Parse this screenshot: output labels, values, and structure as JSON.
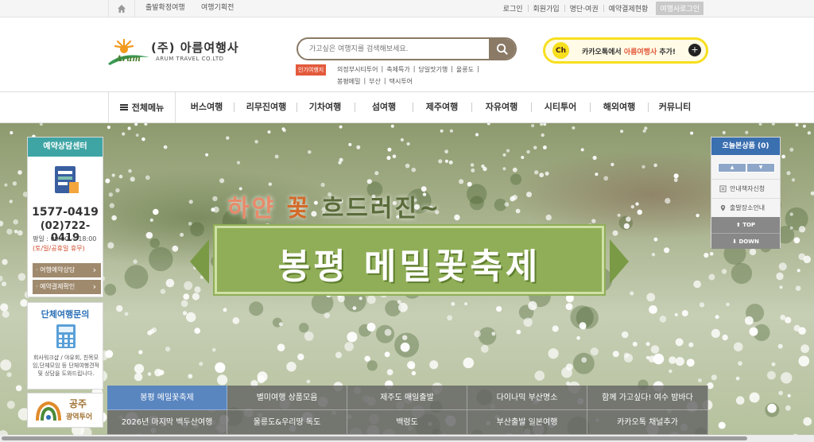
{
  "topbar": {
    "links": [
      "출발확정여행",
      "여행기획전"
    ],
    "util": [
      "로그인",
      "회원가입",
      "명단·여권",
      "예약결제현황"
    ],
    "agent_login": "여행사로그인"
  },
  "logo": {
    "arum": "Arum",
    "main": "(주) 아름여행사",
    "sub": "ARUM TRAVEL CO.LTD"
  },
  "search": {
    "placeholder": "가고싶은 여행지를 검색해보세요."
  },
  "popular": {
    "label": "인기여행지",
    "row1": [
      "의정부시티투어",
      "|",
      "축제특가",
      "|",
      "당일맛기행",
      "|",
      "울릉도",
      "|"
    ],
    "row2": [
      "봉평메밀",
      "|",
      "부산",
      "|",
      "택시투어"
    ]
  },
  "kakao": {
    "ch": "Ch",
    "text_pre": "카카오톡에서 ",
    "text_em": "아름여행사",
    "text_post": " 추가!",
    "plus": "+"
  },
  "nav": {
    "all": "전체메뉴",
    "items": [
      "버스여행",
      "리무진여행",
      "기차여행",
      "섬여행",
      "제주여행",
      "자유여행",
      "시티투어",
      "해외여행",
      "커뮤니티"
    ]
  },
  "hero": {
    "sub_a": "하얀 ",
    "sub_b": "꽃",
    "sub_c": " 흐드러진~",
    "title": "봉평 메밀꽃축제",
    "colors": {
      "sub": "#e88a6a",
      "sub_accent": "#d46a2a",
      "sub_dark": "#5a6b3a",
      "banner": "#8fae57"
    }
  },
  "left": {
    "head": "예약상담센터",
    "tel1": "1577-0419",
    "tel2": "(02)722-0419",
    "hours": "평일 : 09:00 ~ 18:00",
    "off": "(토/일/공휴일 휴무)",
    "btn1": "· 여행예약상담",
    "btn2": "· 예약결제확인",
    "group_title": "단체여행문의",
    "group_desc": "회사워크샵 / 야유회, 친목모임,단체모임 등 단체여행견적 및 상담을 도와드립니다.",
    "gongju1": "공주",
    "gongju2": "광역투어"
  },
  "right": {
    "head": "오늘본상품 (0)",
    "up": "▲",
    "down": "▼",
    "link1": "안내책자신청",
    "link2": "출발장소안내",
    "top": "⬆ TOP",
    "bottom": "⬇ DOWN"
  },
  "tabs": {
    "row1": [
      "봉평 메밀꽃축제",
      "별미여행 상품모음",
      "제주도 매일출발",
      "다이나믹 부산명소",
      "함께 가고싶다! 여수 밤바다"
    ],
    "row2": [
      "2026년 마지막 백두산여행",
      "울릉도&우리땅 독도",
      "백령도",
      "부산출발 일본여행",
      "카카오톡 채널추가"
    ],
    "active_index": 0
  },
  "scrollbar": {
    "thumb_fraction": 0.92
  },
  "colors": {
    "teal": "#3fa5a4",
    "blue": "#3a6fb0",
    "kakao_yellow": "#f7df1e",
    "accent_red": "#e35a3c",
    "tab_active": "#5a86c0"
  }
}
